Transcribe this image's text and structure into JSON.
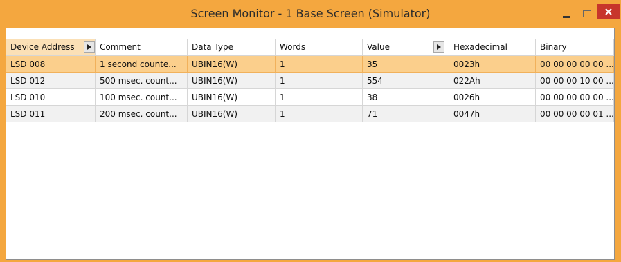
{
  "window": {
    "title": "Screen Monitor - 1  Base Screen (Simulator)",
    "accent_color": "#f4a73f",
    "close_color": "#c7352b",
    "controls": [
      "minimize-icon",
      "maximize-icon",
      "close-icon"
    ]
  },
  "table": {
    "columns": [
      "Device Address",
      "Comment",
      "Data Type",
      "Words",
      "Value",
      "Hexadecimal",
      "Binary"
    ],
    "rows": [
      [
        "LSD 008",
        "1 second counte...",
        "UBIN16(W)",
        "1",
        "35",
        "0023h",
        "00 00 00 00 00 ..."
      ],
      [
        "LSD 012",
        "500 msec. count...",
        "UBIN16(W)",
        "1",
        "554",
        "022Ah",
        "00 00 00 10 00 ..."
      ],
      [
        "LSD 010",
        "100 msec. count...",
        "UBIN16(W)",
        "1",
        "38",
        "0026h",
        "00 00 00 00 00 ..."
      ],
      [
        "LSD 011",
        "200 msec. count...",
        "UBIN16(W)",
        "1",
        "71",
        "0047h",
        "00 00 00 00 01 ..."
      ]
    ],
    "selected_row": 0
  }
}
